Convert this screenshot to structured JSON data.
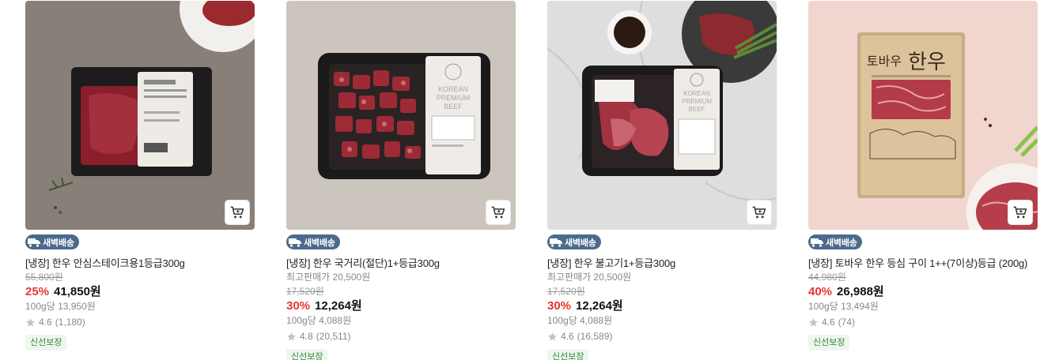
{
  "products": [
    {
      "delivery_badge": "새벽배송",
      "name": "[냉장] 한우 안심스테이크용1등급300g",
      "sub_note": "",
      "original_price": "55,800원",
      "discount": "25%",
      "price": "41,850원",
      "unit_price": "100g당 13,950원",
      "rating": "4.6",
      "reviews": "(1,180)",
      "tag": "신선보장",
      "package_text": [],
      "image_bg": "#8a817b"
    },
    {
      "delivery_badge": "새벽배송",
      "name": "[냉장] 한우 국거리(절단)1+등급300g",
      "sub_note": "최고판매가 20,500원",
      "original_price": "17,520원",
      "discount": "30%",
      "price": "12,264원",
      "unit_price": "100g당 4,088원",
      "rating": "4.8",
      "reviews": "(20,511)",
      "tag": "신선보장",
      "package_text": [
        "KOREAN",
        "PREMIUM",
        "BEEF"
      ],
      "image_bg": "#c9c3bc"
    },
    {
      "delivery_badge": "새벽배송",
      "name": "[냉장] 한우 불고기1+등급300g",
      "sub_note": "최고판매가 20,500원",
      "original_price": "17,520원",
      "discount": "30%",
      "price": "12,264원",
      "unit_price": "100g당 4,088원",
      "rating": "4.6",
      "reviews": "(16,589)",
      "tag": "신선보장",
      "package_text": [
        "KOREAN",
        "PREMIUM",
        "BEEF"
      ],
      "image_bg": "#dcdcdc"
    },
    {
      "delivery_badge": "새벽배송",
      "name": "[냉장] 토바우 한우 등심 구이 1++(7이상)등급 (200g)",
      "sub_note": "",
      "original_price": "44,980원",
      "discount": "40%",
      "price": "26,988원",
      "unit_price": "100g당 13,494원",
      "rating": "4.6",
      "reviews": "(74)",
      "tag": "신선보장",
      "package_text": [
        "토바우",
        "한우"
      ],
      "image_bg": "#f0d5cf"
    }
  ],
  "colors": {
    "discount": "#e8352e",
    "badge": "#4b6b8c",
    "fresh_tag": "#2f8a3b"
  },
  "icons": {
    "cart": "cart-icon",
    "truck": "truck-icon",
    "star": "star-icon"
  }
}
